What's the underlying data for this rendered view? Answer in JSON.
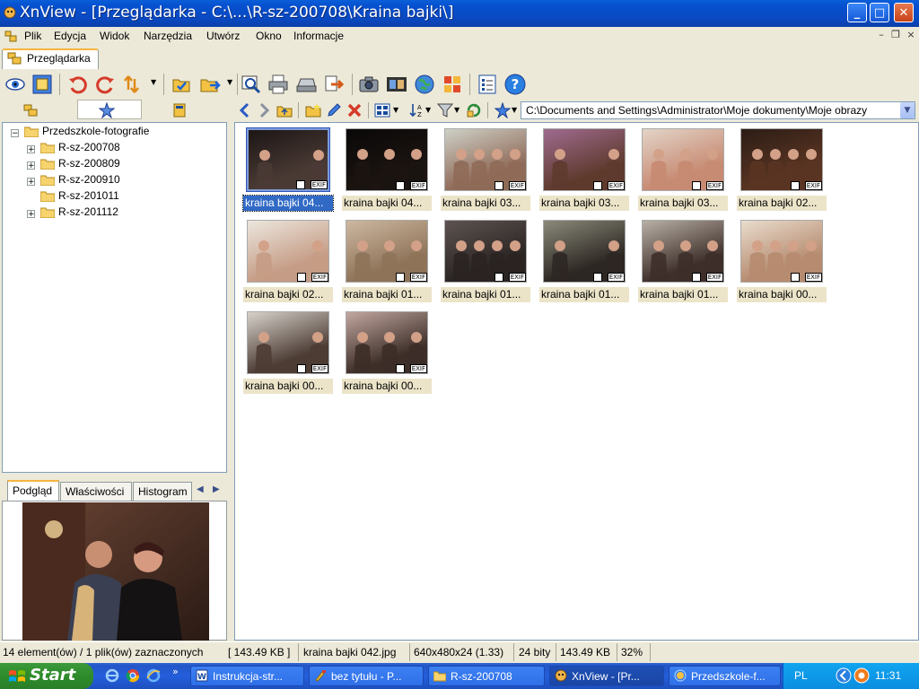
{
  "window": {
    "title": "XnView - [Przeglądarka - C:\\...\\R-sz-200708\\Kraina bajki\\]",
    "min": "_",
    "max": "□",
    "close": "✕"
  },
  "menu": {
    "items": [
      "Plik",
      "Edycja",
      "Widok",
      "Narzędzia",
      "Utwórz",
      "Okno",
      "Informacje"
    ]
  },
  "tab": {
    "label": "Przeglądarka"
  },
  "address": {
    "path": "C:\\Documents and Settings\\Administrator\\Moje dokumenty\\Moje obrazy"
  },
  "tree": {
    "root": "Przedszkole-fotografie",
    "folders": [
      "R-sz-200708",
      "R-sz-200809",
      "R-sz-200910",
      "R-sz-201011",
      "R-sz-201112"
    ]
  },
  "preview_tabs": [
    "Podgląd",
    "Właściwości",
    "Histogram"
  ],
  "thumbnails": [
    {
      "caption": "kraina bajki 04...",
      "exif": "EXIF",
      "selected": true,
      "colors": [
        "#4a3a34",
        "#1c1616"
      ]
    },
    {
      "caption": "kraina bajki 04...",
      "exif": "EXIF",
      "selected": false,
      "colors": [
        "#1b1411",
        "#0a0808"
      ]
    },
    {
      "caption": "kraina bajki 03...",
      "exif": "EXIF",
      "selected": false,
      "colors": [
        "#8f6a58",
        "#ced0c6"
      ]
    },
    {
      "caption": "kraina bajki 03...",
      "exif": "EXIF",
      "selected": false,
      "colors": [
        "#5e3a2d",
        "#9f6b8f"
      ]
    },
    {
      "caption": "kraina bajki 03...",
      "exif": "EXIF",
      "selected": false,
      "colors": [
        "#c78a72",
        "#e3d4c8"
      ]
    },
    {
      "caption": "kraina bajki 02...",
      "exif": "EXIF",
      "selected": false,
      "colors": [
        "#5a3422",
        "#2c1d16"
      ]
    },
    {
      "caption": "kraina bajki 02...",
      "exif": "EXIF",
      "selected": false,
      "colors": [
        "#c59c85",
        "#ece6de"
      ]
    },
    {
      "caption": "kraina bajki 01...",
      "exif": "EXIF",
      "selected": false,
      "colors": [
        "#8e7359",
        "#cdb8a0"
      ]
    },
    {
      "caption": "kraina bajki 01...",
      "exif": "EXIF",
      "selected": false,
      "colors": [
        "#2a2422",
        "#5d5451"
      ]
    },
    {
      "caption": "kraina bajki 01...",
      "exif": "EXIF",
      "selected": false,
      "colors": [
        "#2d2723",
        "#8a8a7a"
      ]
    },
    {
      "caption": "kraina bajki 01...",
      "exif": "EXIF",
      "selected": false,
      "colors": [
        "#3e2f2a",
        "#b9b0a6"
      ]
    },
    {
      "caption": "kraina bajki 00...",
      "exif": "EXIF",
      "selected": false,
      "colors": [
        "#b68b6f",
        "#e9dccd"
      ]
    },
    {
      "caption": "kraina bajki 00...",
      "exif": "EXIF",
      "selected": false,
      "colors": [
        "#4c3c34",
        "#d7d2cb"
      ]
    },
    {
      "caption": "kraina bajki 00...",
      "exif": "EXIF",
      "selected": false,
      "colors": [
        "#3d2e28",
        "#c2a7a0"
      ]
    }
  ],
  "status": {
    "count": "14 element(ów) / 1 plik(ów) zaznaczonych",
    "size_sel": "[ 143.49 KB ]",
    "filename": "kraina bajki 042.jpg",
    "dims": "640x480x24 (1.33)",
    "bits": "24 bity",
    "filesize": "143.49 KB",
    "zoom": "32%"
  },
  "taskbar": {
    "start": "Start",
    "tasks": [
      {
        "label": "Instrukcja-str...",
        "active": false
      },
      {
        "label": "bez tytułu - P...",
        "active": false
      },
      {
        "label": "R-sz-200708",
        "active": false
      },
      {
        "label": "XnView - [Pr...",
        "active": true
      },
      {
        "label": "Przedszkole-f...",
        "active": false
      }
    ],
    "lang": "PL",
    "clock": "11:31"
  },
  "colors": {
    "accent": "#316ac5",
    "title": "#0a49c1",
    "caption_bg": "#ebe4c9"
  }
}
